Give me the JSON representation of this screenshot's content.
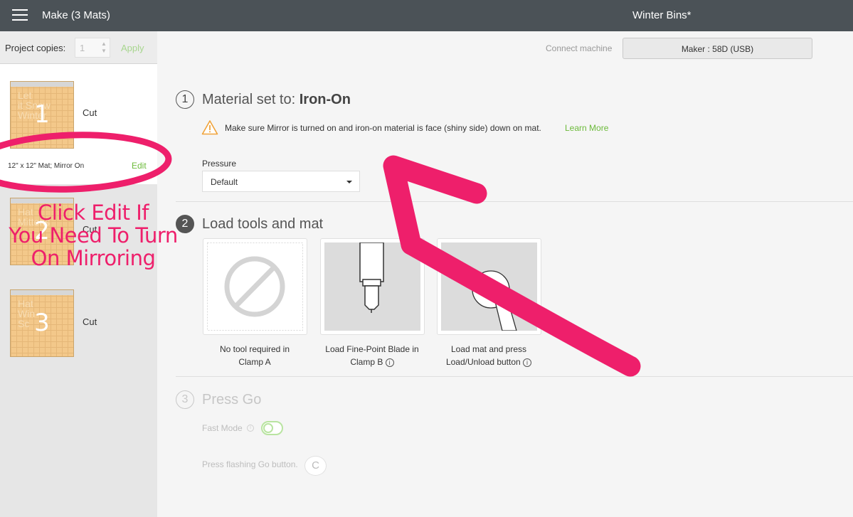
{
  "header": {
    "menu_icon": "hamburger-menu-icon",
    "app_title": "Make (3 Mats)",
    "project_title": "Winter Bins*"
  },
  "sidebar": {
    "copies_label": "Project copies:",
    "copies_value": "1",
    "apply_label": "Apply",
    "mats": [
      {
        "number": "1",
        "label": "Cut",
        "description": "12\" x 12\" Mat; Mirror On",
        "edit_label": "Edit",
        "active": true
      },
      {
        "number": "2",
        "label": "Cut"
      },
      {
        "number": "3",
        "label": "Cut"
      }
    ]
  },
  "machine": {
    "connect_label": "Connect machine",
    "machine_label": "Maker : 58D (USB)"
  },
  "step1": {
    "number": "1",
    "title_prefix": "Material set to:",
    "material": "Iron-On",
    "warning_icon": "warning-triangle-icon",
    "warning_text": "Make sure Mirror is turned on and iron-on material is face (shiny side) down on mat.",
    "learn_more": "Learn More",
    "pressure_label": "Pressure",
    "pressure_value": "Default"
  },
  "step2": {
    "number": "2",
    "title": "Load tools and mat",
    "tools": [
      {
        "icon": "no-tool-icon",
        "caption_line1": "No tool required in",
        "caption_line2": "Clamp A"
      },
      {
        "icon": "fine-point-blade-icon",
        "caption_line1": "Load Fine-Point Blade in",
        "caption_line2": "Clamp B"
      },
      {
        "icon": "load-mat-hand-icon",
        "caption_line1": "Load mat and press",
        "caption_line2": "Load/Unload button"
      }
    ]
  },
  "step3": {
    "number": "3",
    "title": "Press Go",
    "fast_mode_label": "Fast Mode",
    "go_instruction": "Press flashing Go button.",
    "go_icon": "cricut-go-icon"
  },
  "annotation": {
    "line1": "Click Edit If",
    "line2": "You Need To Turn",
    "line3": "On Mirroring",
    "color": "#ee1f6b"
  }
}
